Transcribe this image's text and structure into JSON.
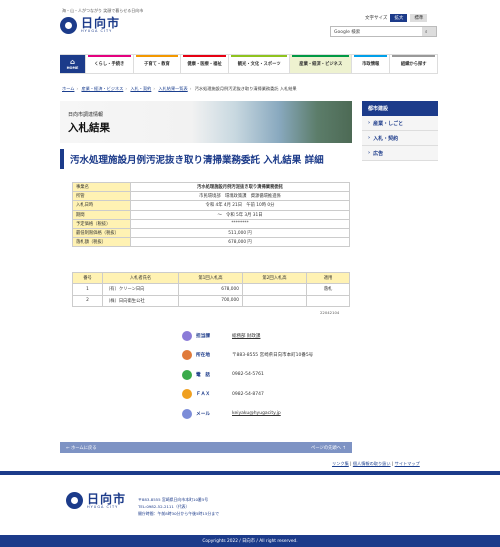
{
  "header": {
    "tagline": "海・山・人がつながり 笑顔で暮らせる日向市",
    "logo_name": "日向市",
    "logo_sub": "HYUGA CITY",
    "font_size_label": "文字サイズ",
    "font_large": "拡大",
    "font_standard": "標準",
    "search_placeholder": "Google 検索",
    "search_icon": "magnifier-icon"
  },
  "nav": {
    "home": "HOME",
    "items": [
      "くらし・手続き",
      "子育て・教育",
      "健康・医療・福祉",
      "観光・文化・スポーツ",
      "産業・経済・ビジネス",
      "市政情報",
      "組織から探す"
    ],
    "colors": [
      "#e4007f",
      "#f39800",
      "#e60012",
      "#8fc31f",
      "#009944",
      "#00a0e9",
      "#999999"
    ]
  },
  "breadcrumb": [
    "ホーム",
    "産業・経済・ビジネス",
    "入札・契約",
    "入札結果一覧表",
    "汚水処理施設月例汚泥抜き取り清掃業務委託 入札結果"
  ],
  "banner": {
    "sub": "日向市調達情報",
    "title": "入札結果"
  },
  "sidebar": {
    "header": "都市建設",
    "items": [
      "産業・しごと",
      "入札・契約",
      "広告"
    ]
  },
  "page_title": "汚水処理施設月例汚泥抜き取り清掃業務委託 入札結果 詳細",
  "details": [
    {
      "k": "事業名",
      "v": "汚水処理施設月例汚泥抜き取り清掃業務委託"
    },
    {
      "k": "所管",
      "v": "市民環境部　環境政策課　資源循環推進係"
    },
    {
      "k": "入札日時",
      "v": "令和 4年 4月 21日　午前 10時 0分"
    },
    {
      "k": "期間",
      "v": "〜　令和 5年 3月 31日"
    },
    {
      "k": "予定価格（税抜）",
      "v": "********"
    },
    {
      "k": "最低制限価格（税抜）",
      "v": "511,000 円"
    },
    {
      "k": "落札額（税抜）",
      "v": "678,000 円"
    }
  ],
  "bids": {
    "headers": [
      "番号",
      "入札者氏名",
      "第1回入札高",
      "第2回入札高",
      "適用"
    ],
    "rows": [
      {
        "no": "1",
        "name": "（有）クリーン日向",
        "r1": "678,000",
        "r2": "",
        "note": "落札"
      },
      {
        "no": "2",
        "name": "（株）日向衛生公社",
        "r1": "700,000",
        "r2": "",
        "note": ""
      }
    ]
  },
  "code": "22042104",
  "contact": [
    {
      "label": "担当課",
      "value": "総務部 財政課",
      "icon": "person-icon",
      "color": "#8b7bd8",
      "link": true
    },
    {
      "label": "所在地",
      "value": "〒883-8555 宮崎県日向市本町10番5号",
      "icon": "map-pin-icon",
      "color": "#e07a3a",
      "link": false
    },
    {
      "label": "電　話",
      "value": "0982-54-5761",
      "icon": "phone-icon",
      "color": "#3aaa4a",
      "link": false
    },
    {
      "label": "ＦＡＸ",
      "value": "0982-54-8747",
      "icon": "fax-icon",
      "color": "#f0a020",
      "link": false
    },
    {
      "label": "メール",
      "value": "keiyaku@hyugacity.jp",
      "icon": "mail-icon",
      "color": "#7b8cd8",
      "link": true
    }
  ],
  "pager": {
    "back": "ホームに戻る",
    "top": "ページの先頭へ"
  },
  "footer_links": [
    "リンク集",
    "個人情報の取り扱い",
    "サイトマップ"
  ],
  "footer": {
    "name": "日向市",
    "sub": "HYUGA CITY",
    "addr": "〒883-8555 宮崎県日向市本町10番5号",
    "tel": "TEL:0982-52-2111（代表）",
    "hours": "開庁時間：午前8時30分から午後5時15分まで",
    "copyright": "Copyrights 2022 / 日向市 / All right reserved."
  }
}
